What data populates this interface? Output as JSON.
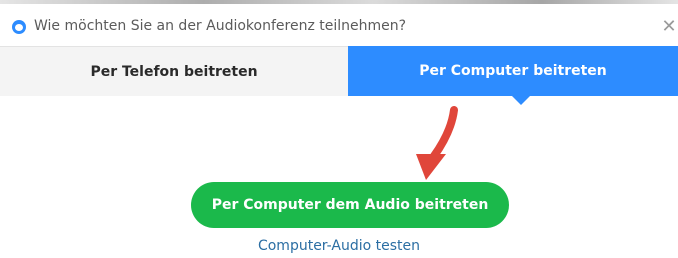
{
  "window": {
    "title": "Wie möchten Sie an der Audiokonferenz teilnehmen?",
    "close_glyph": "✕",
    "icons": {
      "app": "zoom-logo-icon",
      "close": "close-icon",
      "annotation": "red-arrow-icon"
    }
  },
  "tabs": [
    {
      "label": "Per Telefon beitreten",
      "selected": false
    },
    {
      "label": "Per Computer beitreten",
      "selected": true
    }
  ],
  "main": {
    "join_button_label": "Per Computer dem Audio beitreten",
    "test_link_label": "Computer-Audio testen"
  },
  "colors": {
    "accent": "#2d8cff",
    "join_button": "#1bb94b",
    "link": "#2b6ea3",
    "arrow": "#e0463a"
  }
}
